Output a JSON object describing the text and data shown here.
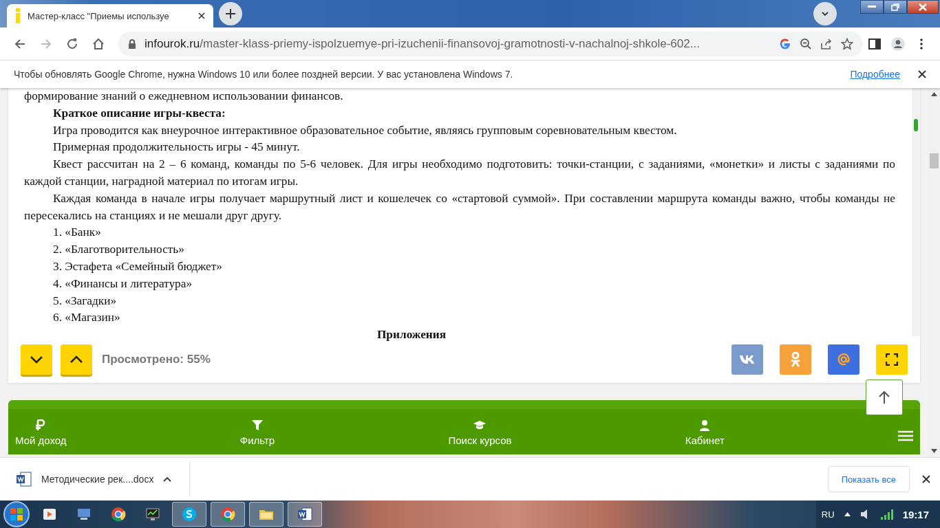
{
  "browser": {
    "tab": {
      "title": "Мастер-класс \"Приемы используе"
    },
    "address": {
      "domain": "infourok.ru",
      "path": "/master-klass-priemy-ispolzuemye-pri-izuchenii-finansovoj-gramotnosti-v-nachalnoj-shkole-602..."
    }
  },
  "infobar": {
    "message": "Чтобы обновлять Google Chrome, нужна Windows 10 или более поздней версии. У вас установлена Windows 7.",
    "link": "Подробнее"
  },
  "document": {
    "paragraphs": [
      {
        "kind": "plain",
        "text": "формирование знаний о ежедневном использовании финансов."
      },
      {
        "kind": "heading",
        "text": "Краткое описание игры-квеста:"
      },
      {
        "kind": "para",
        "text": "Игра проводится как внеурочное интерактивное образовательное событие, являясь групповым соревновательным квестом."
      },
      {
        "kind": "para",
        "text": "Примерная продолжительность игры - 45 минут."
      },
      {
        "kind": "para",
        "text": "Квест рассчитан на 2 – 6 команд, команды по 5-6 человек. Для игры необходимо подготовить:  точки-станции, с заданиями, «монетки» и листы с заданиями по каждой станции, наградной материал по итогам игры."
      },
      {
        "kind": "para",
        "text": " Каждая команда в начале игры получает маршрутный лист и кошелечек со «стартовой суммой». При составлении маршрута команды важно, чтобы команды не пересекались на станциях и не мешали друг другу."
      },
      {
        "kind": "list",
        "number": "1.",
        "text": "«Банк»"
      },
      {
        "kind": "list",
        "number": "2.",
        "text": "«Благотворительность»"
      },
      {
        "kind": "list",
        "number": "3.",
        "text": "Эстафета «Семейный бюджет»"
      },
      {
        "kind": "list",
        "number": "4.",
        "text": "«Финансы и литература»"
      },
      {
        "kind": "list",
        "number": "5.",
        "text": "«Загадки»"
      },
      {
        "kind": "list",
        "number": "6.",
        "text": "«Магазин»"
      },
      {
        "kind": "title",
        "text": "Приложения"
      }
    ]
  },
  "viewer": {
    "progress": "Просмотрено: 55%"
  },
  "nav": {
    "items": [
      {
        "label": "Мой доход"
      },
      {
        "label": "Фильтр"
      },
      {
        "label": "Поиск курсов"
      },
      {
        "label": "Кабинет"
      }
    ]
  },
  "downloads": {
    "file": "Методические рек....docx",
    "show_all": "Показать все"
  },
  "taskbar": {
    "language": "RU",
    "time": "19:17"
  }
}
